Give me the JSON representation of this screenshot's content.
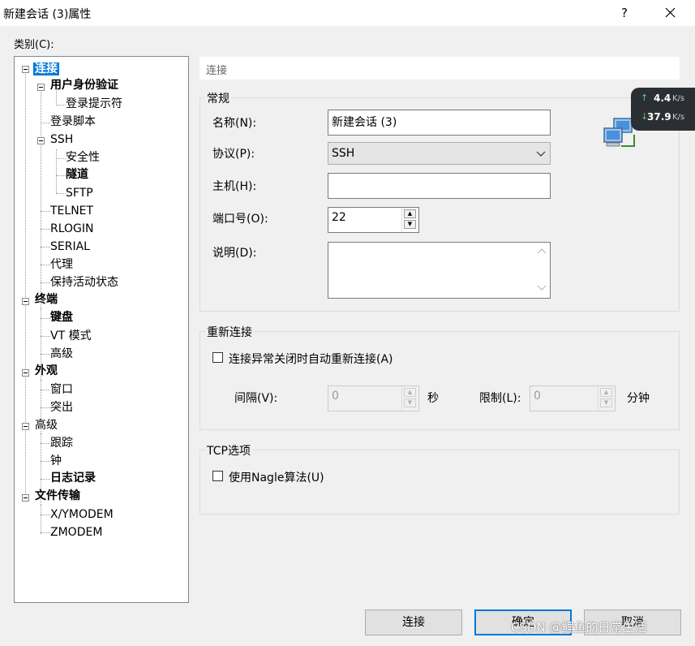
{
  "window": {
    "title": "新建会话 (3)属性",
    "help": "?",
    "close": "✕"
  },
  "category_label": "类别(C):",
  "tree": {
    "connection": "连接",
    "user_auth": "用户身份验证",
    "login_prompt": "登录提示符",
    "login_script": "登录脚本",
    "ssh": "SSH",
    "security": "安全性",
    "tunnel": "隧道",
    "sftp": "SFTP",
    "telnet": "TELNET",
    "rlogin": "RLOGIN",
    "serial": "SERIAL",
    "proxy": "代理",
    "keepalive": "保持活动状态",
    "terminal": "终端",
    "keyboard": "键盘",
    "vt_mode": "VT 模式",
    "advanced": "高级",
    "appearance": "外观",
    "window": "窗口",
    "highlight": "突出",
    "advanced2": "高级",
    "trace": "跟踪",
    "bell": "钟",
    "logging": "日志记录",
    "file_transfer": "文件传输",
    "xymodem": "X/YMODEM",
    "zmodem": "ZMODEM"
  },
  "section_title": "连接",
  "general": {
    "legend": "常规",
    "name_label": "名称(N):",
    "name_value": "新建会话 (3)",
    "protocol_label": "协议(P):",
    "protocol_value": "SSH",
    "host_label": "主机(H):",
    "host_value": "",
    "port_label": "端口号(O):",
    "port_value": "22",
    "desc_label": "说明(D):",
    "desc_value": ""
  },
  "reconnect": {
    "legend": "重新连接",
    "checkbox_label": "连接异常关闭时自动重新连接(A)",
    "checked": false,
    "interval_label": "间隔(V):",
    "interval_value": "0",
    "interval_unit": "秒",
    "limit_label": "限制(L):",
    "limit_value": "0",
    "limit_unit": "分钟"
  },
  "tcp": {
    "legend": "TCP选项",
    "nagle_label": "使用Nagle算法(U)",
    "checked": false
  },
  "buttons": {
    "connect": "连接",
    "ok": "确定",
    "cancel": "取消"
  },
  "net_widget": {
    "upload": "4.4",
    "download": "37.9",
    "unit": "K/s"
  },
  "watermark": "CSDN @鲤鱼的日常生活",
  "colors": {
    "selection": "#0078d7",
    "default_button_border": "#0078d7"
  }
}
